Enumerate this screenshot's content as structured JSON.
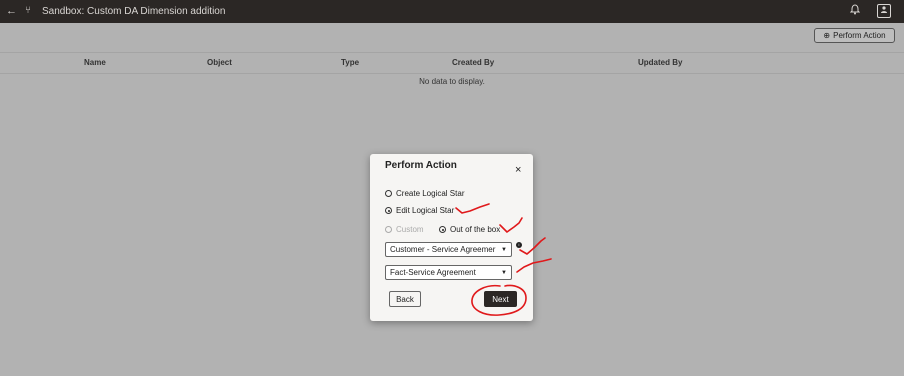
{
  "header": {
    "back_icon": "←",
    "branch_icon": "⑂",
    "title": "Sandbox: Custom DA Dimension addition",
    "bell_icon": "bell-icon",
    "user_icon": "user-icon"
  },
  "toolbar": {
    "perform_action_label": "Perform Action"
  },
  "table": {
    "columns": [
      "Name",
      "Object",
      "Type",
      "Created By",
      "Updated By"
    ],
    "empty_message": "No data to display."
  },
  "modal": {
    "title": "Perform Action",
    "close_label": "×",
    "options": {
      "create": "Create Logical Star",
      "edit": "Edit Logical Star",
      "custom": "Custom",
      "out_of_box": "Out of the box"
    },
    "select_star": "Customer - Service Agreemer",
    "select_fact": "Fact-Service Agreement",
    "back_label": "Back",
    "next_label": "Next"
  },
  "annotation_color": "#e0191b"
}
